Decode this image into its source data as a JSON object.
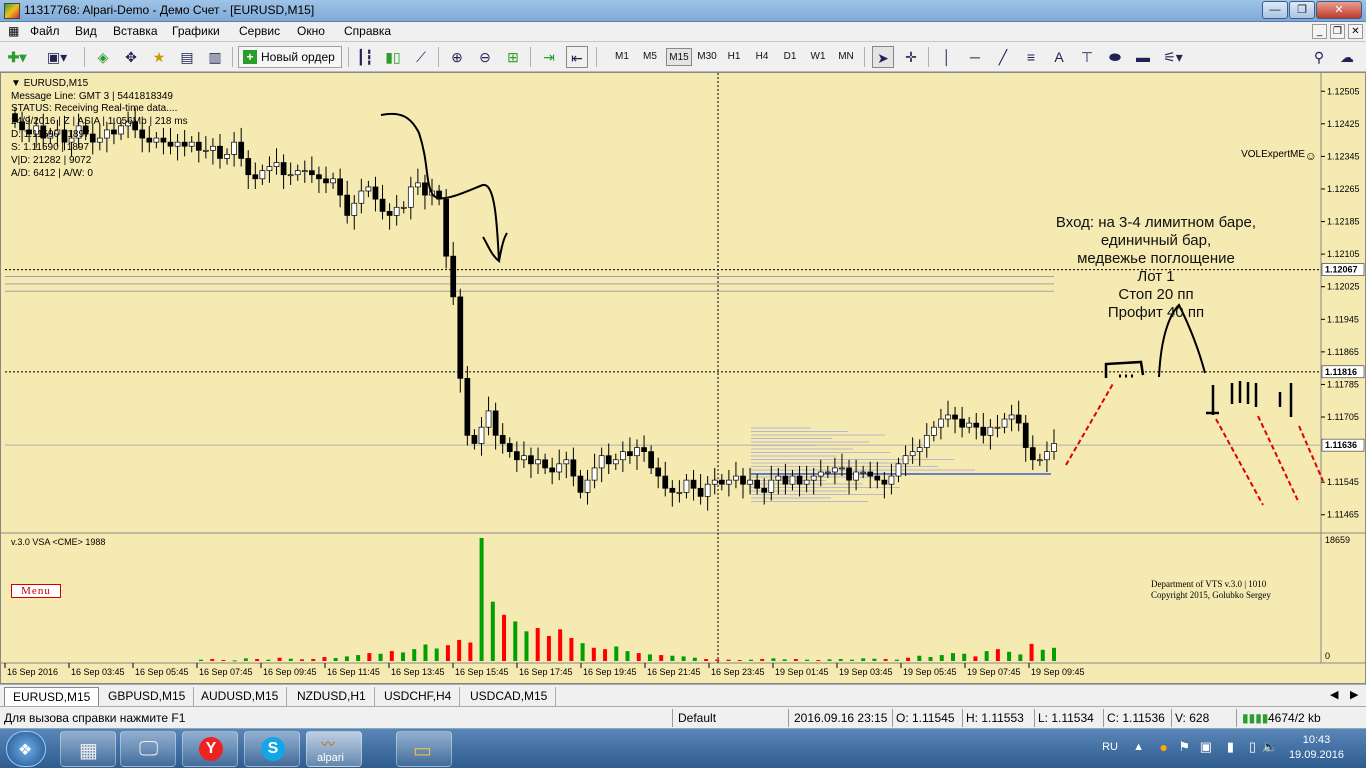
{
  "window": {
    "title": "11317768: Alpari-Demo - Демо Счет - [EURUSD,M15]",
    "controls": [
      "—",
      "❐",
      "✕"
    ]
  },
  "menu": [
    "Файл",
    "Вид",
    "Вставка",
    "Графики",
    "Сервис",
    "Окно",
    "Справка"
  ],
  "toolbar": {
    "new_order_label": "Новый ордер",
    "timeframes": [
      "M1",
      "M5",
      "M15",
      "M30",
      "H1",
      "H4",
      "D1",
      "W1",
      "MN"
    ],
    "active_timeframe": "M15",
    "drawing_tools": [
      "cursor-icon",
      "crosshair-icon",
      "vertical-line-icon",
      "horizontal-line-icon",
      "trendline-icon",
      "channel-icon",
      "text-icon",
      "ellipse-icon",
      "rectangle-icon",
      "shapes-icon"
    ]
  },
  "chart": {
    "symbol_label": "EURUSD,M15",
    "info_lines": [
      "Message Line: GMT 3 | 5441818349",
      "STATUS:  Receiving Real-time data....",
      "24/9/2016 | Z | ASIA | 1.056Mb | 218 ms",
      "D: 1.11590 | 1897",
      "S: 1.11590 | 1897",
      "V|D: 21282 | 9072",
      "A/D: 6412 | A/W: 0"
    ],
    "expert_label": "VOLExpertME",
    "menu_button": "Menu",
    "annotation": [
      "Вход: на 3-4 лимитном баре,",
      "единичный бар,",
      "медвежье поглощение",
      "Лот 1",
      "Стоп 20 пп",
      "Профит 40 пп"
    ],
    "copyright": [
      "Department of VTS  v.3.0 | 1010",
      "Copyright 2015, Golubko Sergey"
    ],
    "volume_label": "v.3.0 VSA <CME> 1988",
    "price_axis": [
      "1.12505",
      "1.12425",
      "1.12345",
      "1.12265",
      "1.12185",
      "1.12105",
      "1.12025",
      "1.11945",
      "1.11865",
      "1.11785",
      "1.11705",
      "1.11545",
      "1.11465"
    ],
    "price_marks": [
      "1.12067",
      "1.11816",
      "1.11636"
    ],
    "volume_axis": [
      "18659",
      "0"
    ],
    "time_axis": [
      "16 Sep 2016",
      "16 Sep 03:45",
      "16 Sep 05:45",
      "16 Sep 07:45",
      "16 Sep 09:45",
      "16 Sep 11:45",
      "16 Sep 13:45",
      "16 Sep 15:45",
      "16 Sep 17:45",
      "16 Sep 19:45",
      "16 Sep 21:45",
      "16 Sep 23:45",
      "19 Sep 01:45",
      "19 Sep 03:45",
      "19 Sep 05:45",
      "19 Sep 07:45",
      "19 Sep 09:45"
    ],
    "colors": {
      "background": "#f4eab2",
      "bull": "#ffffff",
      "bear": "#000000",
      "volume_up": "#00a000",
      "volume_down": "#ff0000",
      "annot_red": "#e00000"
    }
  },
  "chart_data": {
    "type": "candlestick",
    "symbol": "EURUSD",
    "timeframe": "M15",
    "ylim": [
      1.1143,
      1.1254
    ],
    "horizontal_levels": [
      1.12067,
      1.11816,
      1.11636
    ],
    "close_path": [
      1.1243,
      1.1241,
      1.124,
      1.1242,
      1.1239,
      1.124,
      1.1241,
      1.1238,
      1.1239,
      1.1242,
      1.124,
      1.1238,
      1.1239,
      1.1241,
      1.124,
      1.1242,
      1.1243,
      1.1241,
      1.1239,
      1.1238,
      1.1239,
      1.1238,
      1.1237,
      1.1238,
      1.1237,
      1.1238,
      1.1236,
      1.1236,
      1.1237,
      1.1234,
      1.1235,
      1.1238,
      1.1234,
      1.123,
      1.1229,
      1.1231,
      1.1232,
      1.1233,
      1.123,
      1.123,
      1.1231,
      1.1231,
      1.123,
      1.1229,
      1.1228,
      1.1229,
      1.1225,
      1.122,
      1.1223,
      1.1226,
      1.1227,
      1.1224,
      1.1221,
      1.122,
      1.1222,
      1.1222,
      1.1227,
      1.1228,
      1.1225,
      1.1226,
      1.1224,
      1.121,
      1.12,
      1.118,
      1.1166,
      1.1164,
      1.1168,
      1.1172,
      1.1166,
      1.1164,
      1.1162,
      1.116,
      1.1161,
      1.1159,
      1.116,
      1.1158,
      1.1157,
      1.1159,
      1.116,
      1.1156,
      1.1152,
      1.1155,
      1.1158,
      1.1161,
      1.1159,
      1.116,
      1.1162,
      1.1161,
      1.1163,
      1.1162,
      1.1158,
      1.1156,
      1.1153,
      1.1152,
      1.1152,
      1.1155,
      1.1153,
      1.1151,
      1.1154,
      1.1155,
      1.1154,
      1.1155,
      1.1156,
      1.1154,
      1.1155,
      1.1153,
      1.1152,
      1.1155,
      1.1156,
      1.1154,
      1.1156,
      1.1154,
      1.1155,
      1.1156,
      1.1157,
      1.1157,
      1.1158,
      1.1158,
      1.1155,
      1.1157,
      1.1157,
      1.1156,
      1.1155,
      1.1154,
      1.1156,
      1.1159,
      1.1161,
      1.1162,
      1.1163,
      1.1166,
      1.1168,
      1.117,
      1.1171,
      1.117,
      1.1168,
      1.1169,
      1.1168,
      1.1166,
      1.1168,
      1.1168,
      1.117,
      1.1171,
      1.1169,
      1.1163,
      1.116,
      1.116,
      1.1162,
      1.1164
    ],
    "volume_path": [
      200,
      300,
      150,
      100,
      400,
      300,
      200,
      500,
      350,
      250,
      300,
      600,
      450,
      700,
      900,
      1200,
      1100,
      1500,
      1300,
      1800,
      2500,
      1900,
      2400,
      3200,
      2800,
      18659,
      9000,
      7000,
      6000,
      4500,
      5000,
      3800,
      4800,
      3500,
      2700,
      2000,
      1800,
      2200,
      1500,
      1200,
      1000,
      900,
      800,
      700,
      500,
      300,
      250,
      200,
      150,
      200,
      300,
      400,
      250,
      300,
      200,
      150,
      250,
      300,
      200,
      400,
      350,
      300,
      200,
      500,
      800,
      600,
      900,
      1200,
      1100,
      700,
      1500,
      1800,
      1400,
      1000,
      2600,
      1700,
      2000
    ]
  },
  "annotation_shapes": {
    "freehand_curve": "black",
    "entry_sketch": "black",
    "dashed_arrows": "red"
  },
  "tabs": [
    "EURUSD,M15",
    "GBPUSD,M15",
    "AUDUSD,M15",
    "NZDUSD,H1",
    "USDCHF,H4",
    "USDCAD,M15"
  ],
  "active_tab": "EURUSD,M15",
  "statusbar": {
    "help": "Для вызова справки нажмите F1",
    "profile": "Default",
    "datetime": "2016.09.16 23:15",
    "open": "O: 1.11545",
    "high": "H: 1.11553",
    "low": "L: 1.11534",
    "close": "C: 1.11536",
    "volume": "V: 628",
    "traffic": "4674/2 kb"
  },
  "taskbar": {
    "lang": "RU",
    "time": "10:43",
    "date": "19.09.2016",
    "apps": [
      "calculator-icon",
      "computer-icon",
      "yandex-icon",
      "skype-icon",
      "alpari-icon",
      "explorer-icon"
    ],
    "alpari_label": "alpari"
  }
}
